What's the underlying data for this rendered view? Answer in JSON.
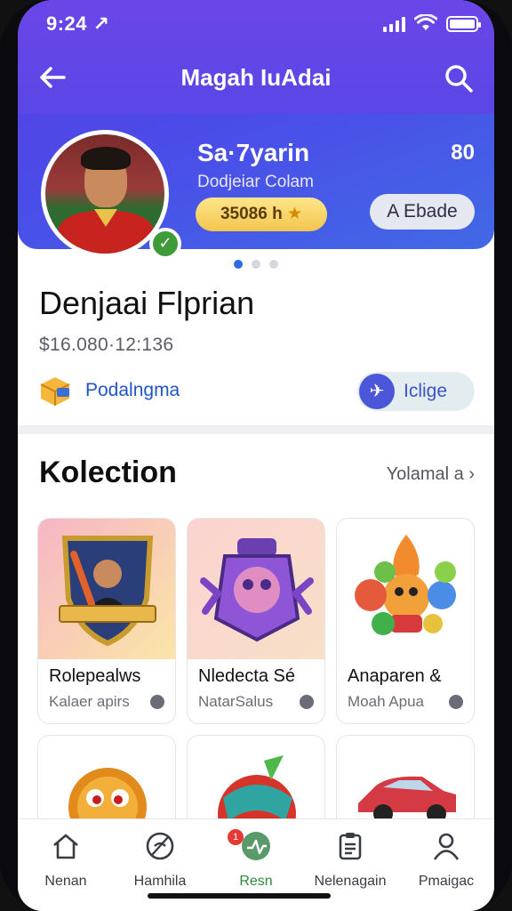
{
  "status_bar": {
    "time": "9:24 ↗"
  },
  "app_bar": {
    "title": "Magah IuAdai"
  },
  "hero": {
    "name": "Sa·7yarin",
    "score": "80",
    "subtitle": "Dodjeiar Colam",
    "gold_pill": "35086 h",
    "gold_pill_icon": "★",
    "action_pill": "A Ebade"
  },
  "profile": {
    "name": "Denjaai Flprian",
    "price": "$16.080·12:136",
    "link_label": "Podalngma",
    "badge_label": "Iclige"
  },
  "collection": {
    "title": "Kolection",
    "see_all": "Yolamal a",
    "items": [
      {
        "title": "Rolepealws",
        "subtitle": "Kalaer apirs"
      },
      {
        "title": "Nledecta Sé",
        "subtitle": "NatarSalus"
      },
      {
        "title": "Anaparen &",
        "subtitle": "Moah Apua"
      }
    ]
  },
  "tabs": [
    {
      "label": "Nenan"
    },
    {
      "label": "Hamhila"
    },
    {
      "label": "Resn"
    },
    {
      "label": "Nelenagain"
    },
    {
      "label": "Pmaigac"
    }
  ],
  "tab_badge": "1",
  "colors": {
    "primary": "#5b46e6",
    "accent_green": "#2e8a3a",
    "link_blue": "#1f55c9"
  }
}
